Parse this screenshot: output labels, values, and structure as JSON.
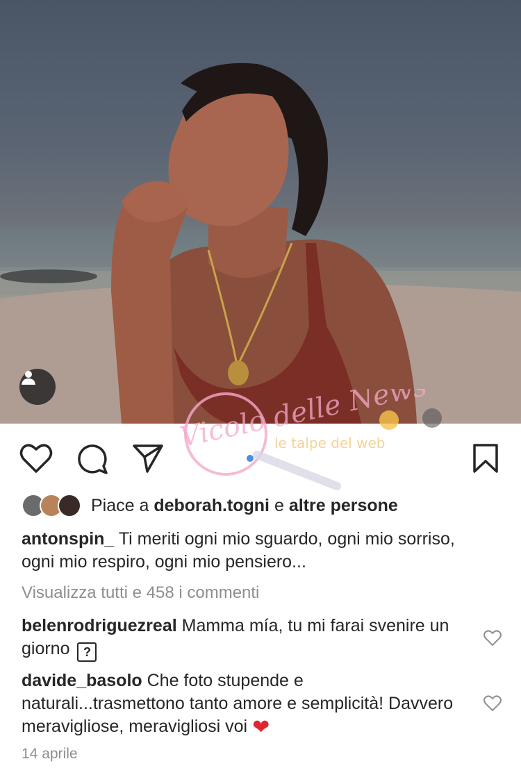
{
  "photo": {
    "subject": "woman-on-beach-at-dusk"
  },
  "actions": {
    "like_icon": "heart-outline-icon",
    "comment_icon": "comment-bubble-icon",
    "share_icon": "paper-plane-icon",
    "save_icon": "bookmark-icon"
  },
  "watermark": {
    "text_main": "Vicolo delle News",
    "text_side": "le talpe del web"
  },
  "likes": {
    "prefix": "Piace a",
    "user": "deborah.togni",
    "joiner": "e",
    "others": "altre persone"
  },
  "caption": {
    "username": "antonspin_",
    "text": "Ti meriti ogni mio sguardo, ogni mio sorriso, ogni mio respiro, ogni mio pensiero..."
  },
  "view_all_comments": "Visualizza tutti e 458 i commenti",
  "comments": [
    {
      "username": "belenrodriguezreal",
      "text": "Mamma mía, tu mi farai svenire un giorno",
      "tail": "?"
    },
    {
      "username": "davide_basolo",
      "text": "Che foto stupende e naturali...trasmettono tanto amore e semplicità! Davvero meravigliose, meravigliosi voi",
      "tail": "❤"
    }
  ],
  "date": "14 aprile",
  "colors": {
    "text": "#262626",
    "muted": "#8e8e8e",
    "heart": "#e0262f",
    "watermark_pink": "#f4a9c9"
  }
}
